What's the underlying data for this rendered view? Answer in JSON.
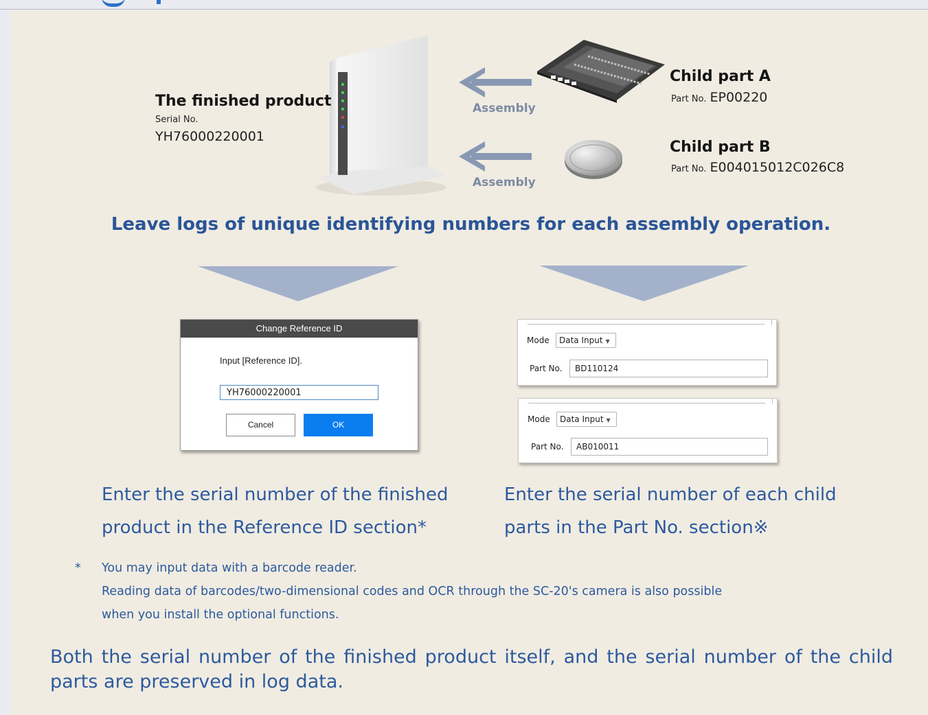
{
  "finished_product": {
    "title": "The finished product",
    "serial_label": "Serial No.",
    "serial_value": "YH76000220001"
  },
  "child_a": {
    "title": "Child part A",
    "part_no_label": "Part No.",
    "part_no_value": "EP00220"
  },
  "child_b": {
    "title": "Child part B",
    "part_no_label": "Part No.",
    "part_no_value": "E004015012C026C8"
  },
  "arrows": {
    "top_label": "Assembly",
    "bottom_label": "Assembly"
  },
  "headline": "Leave logs of unique identifying numbers for each assembly operation.",
  "dialog": {
    "title": "Change Reference ID",
    "prompt": "Input [Reference ID].",
    "input_value": "YH76000220001",
    "cancel_label": "Cancel",
    "ok_label": "OK"
  },
  "part_panels": [
    {
      "mode_label": "Mode",
      "mode_value": "Data Input",
      "part_label": "Part No.",
      "part_value": "BD110124"
    },
    {
      "mode_label": "Mode",
      "mode_value": "Data Input",
      "part_label": "Part No.",
      "part_value": "AB010011"
    }
  ],
  "captions": {
    "left_line1": "Enter the serial number of the finished",
    "left_line2": "product in the Reference ID section*",
    "right_line1": "Enter the serial number of each child",
    "right_line2": "parts in the Part No. section※"
  },
  "footnote": {
    "marker": "*",
    "line1": "You may input data with a barcode reader.",
    "line2": "Reading data of barcodes/two-dimensional codes and OCR through the SC-20's camera is also possible",
    "line3": "when you install the optional functions."
  },
  "conclusion": "Both the serial number of the finished product itself, and the serial number of the child parts are preserved in log data.",
  "colors": {
    "accent_text": "#2d5a9e",
    "headline": "#2a5598",
    "ok_button": "#0a7ef0",
    "panel_bg": "#f0ece2",
    "chevron": "#a4b1cb"
  }
}
